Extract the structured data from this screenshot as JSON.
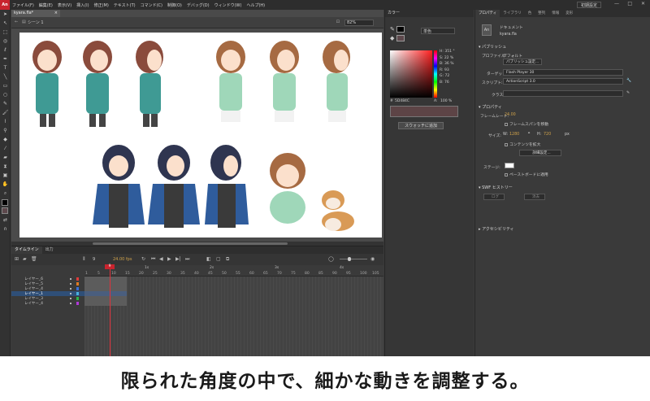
{
  "menubar": {
    "logo": "An",
    "items": [
      "ファイル(F)",
      "編集(E)",
      "表示(V)",
      "挿入(I)",
      "修正(M)",
      "テキスト(T)",
      "コマンド(C)",
      "制御(O)",
      "デバッグ(D)",
      "ウィンドウ(W)",
      "ヘルプ(H)"
    ],
    "workspace": "初期設定"
  },
  "document": {
    "tab_name": "kyara.fla*",
    "scene": "シーン 1",
    "zoom": "82%"
  },
  "timeline": {
    "tabs": [
      "タイムライン",
      "出力"
    ],
    "current_frame": "9",
    "fps": "24.00 fps",
    "seconds": [
      "1s",
      "2s",
      "3s",
      "4s"
    ],
    "ruler_ticks": [
      "1",
      "5",
      "10",
      "15",
      "20",
      "25",
      "30",
      "35",
      "40",
      "45",
      "50",
      "55",
      "60",
      "65",
      "70",
      "75",
      "80",
      "85",
      "90",
      "95",
      "100",
      "105"
    ],
    "layers": [
      {
        "name": "レイヤー_6",
        "color": "#e03b3b",
        "selected": false
      },
      {
        "name": "レイヤー_5",
        "color": "#e07a22",
        "selected": false
      },
      {
        "name": "レイヤー_4",
        "color": "#3a6fd8",
        "selected": false
      },
      {
        "name": "レイヤー_1",
        "color": "#4ab0e0",
        "selected": true
      },
      {
        "name": "レイヤー_3",
        "color": "#2bb44a",
        "selected": false
      },
      {
        "name": "レイヤー_4",
        "color": "#b03ad8",
        "selected": false
      }
    ]
  },
  "color_panel": {
    "title": "カラー",
    "fill_type": "単色",
    "hsb": [
      {
        "label": "H:",
        "value": "351 °"
      },
      {
        "label": "S:",
        "value": "22 %"
      },
      {
        "label": "B:",
        "value": "36 %"
      },
      {
        "label": "R:",
        "value": "93"
      },
      {
        "label": "G:",
        "value": "72"
      },
      {
        "label": "B:",
        "value": "76"
      }
    ],
    "hex_label": "#",
    "hex": "5D484C",
    "alpha_label": "A:",
    "alpha": "100 %",
    "add_swatch": "スウォッチに追加",
    "preview_color": "#5d484c"
  },
  "properties": {
    "tabs": [
      "プロパティ",
      "ライブラリ",
      "色",
      "整列",
      "情報",
      "変形"
    ],
    "doc_label": "ドキュメント",
    "doc_name": "kyara.fla",
    "publish_section": "パブリッシュ",
    "profile_label": "プロファイル:",
    "profile_value": "デフォルト",
    "publish_settings": "パブリッシュ設定...",
    "target_label": "ターゲット:",
    "target_value": "Flash Player 30",
    "script_label": "スクリプト:",
    "script_value": "ActionScript 3.0",
    "class_label": "クラス:",
    "props_section": "プロパティ",
    "fps_label": "フレームレート:",
    "fps_value": "24.00",
    "frame_span": "フレームスパンを移動",
    "size_label": "サイズ:",
    "w_label": "W:",
    "w_value": "1280",
    "h_label": "H:",
    "h_value": "720",
    "unit": "px",
    "scale_content": "コンテンツを拡大",
    "advanced": "詳細設定...",
    "stage_label": "ステージ:",
    "apply_pasteboard": "ペーストボードに適用",
    "swf_section": "SWF ヒストリー",
    "log_btn": "ログ",
    "clear_btn": "消去",
    "accessibility_section": "アクセシビリティ"
  },
  "caption": "限られた角度の中で、細かな動きを調整する。"
}
